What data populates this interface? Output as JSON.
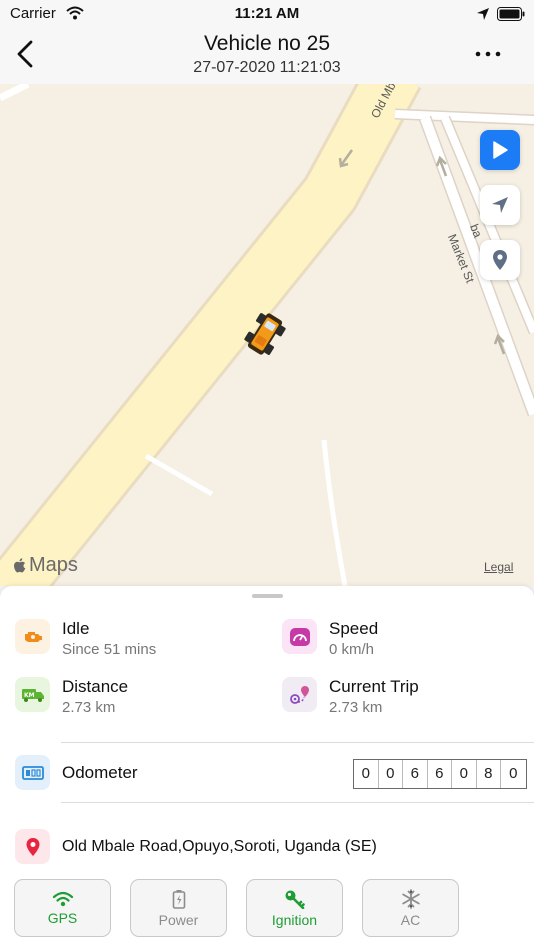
{
  "status_bar": {
    "carrier": "Carrier",
    "time": "11:21 AM"
  },
  "nav": {
    "title": "Vehicle no 25",
    "subtitle": "27-07-2020 11:21:03"
  },
  "map": {
    "street_labels": [
      "Old Mba",
      "Market St",
      "ba"
    ],
    "attribution": "Maps",
    "legal": "Legal"
  },
  "stats": {
    "status": {
      "label": "Idle",
      "value": "Since 51 mins"
    },
    "speed": {
      "label": "Speed",
      "value": "0 km/h"
    },
    "distance": {
      "label": "Distance",
      "value": "2.73 km"
    },
    "current_trip": {
      "label": "Current Trip",
      "value": "2.73 km"
    }
  },
  "odometer": {
    "label": "Odometer",
    "digits": [
      "0",
      "0",
      "6",
      "6",
      "0",
      "8",
      "0"
    ]
  },
  "address": "Old Mbale Road,Opuyo,Soroti, Uganda (SE)",
  "indicators": [
    {
      "label": "GPS",
      "state": "on"
    },
    {
      "label": "Power",
      "state": "off"
    },
    {
      "label": "Ignition",
      "state": "on"
    },
    {
      "label": "AC",
      "state": "off"
    }
  ],
  "colors": {
    "accent": "#1b7cf5",
    "active": "#1f9d35",
    "inactive": "#8c8c8c",
    "map_background": "#f6efe3",
    "road": "#fdf3c4"
  }
}
